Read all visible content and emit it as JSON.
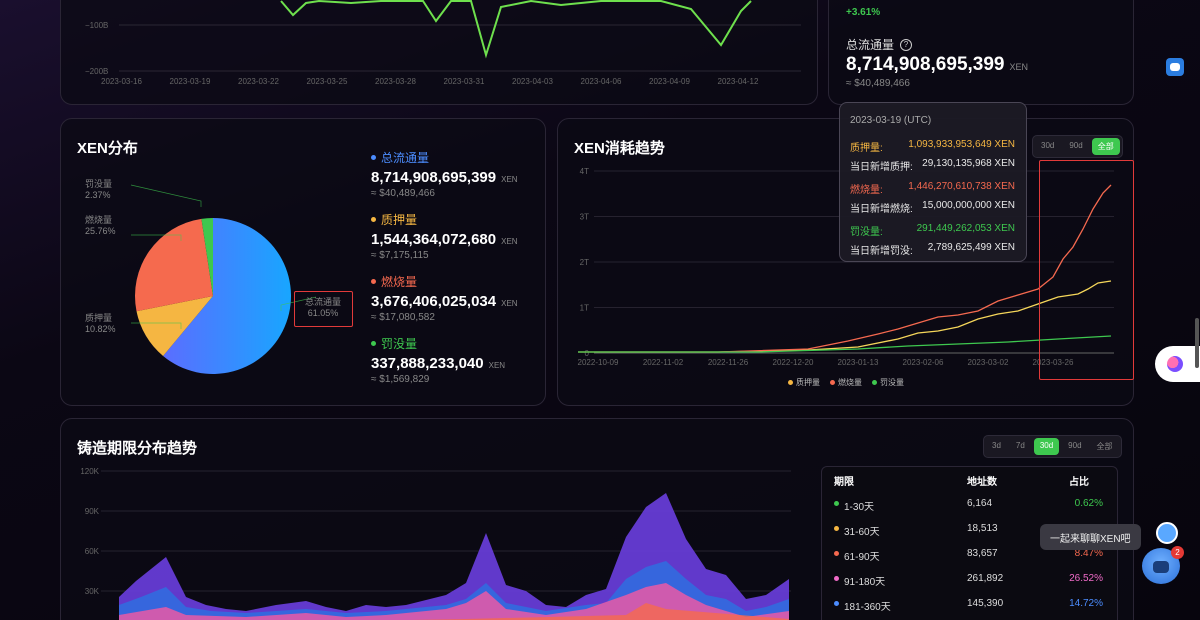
{
  "top_chart": {
    "y_ticks": [
      "−100B",
      "−200B"
    ],
    "x_ticks": [
      "2023-03-16",
      "2023-03-19",
      "2023-03-22",
      "2023-03-25",
      "2023-03-28",
      "2023-03-31",
      "2023-04-03",
      "2023-04-06",
      "2023-04-09",
      "2023-04-12"
    ]
  },
  "top_right": {
    "change": "+3.61%",
    "label": "总流通量",
    "value": "8,714,908,695,399",
    "unit": "XEN",
    "usd": "≈ $40,489,466"
  },
  "distribution": {
    "title": "XEN分布",
    "pie_labels": [
      {
        "name": "罚没量",
        "pct": "2.37%"
      },
      {
        "name": "燃烧量",
        "pct": "25.76%"
      },
      {
        "name": "质押量",
        "pct": "10.82%"
      },
      {
        "name": "总流通量",
        "pct": "61.05%"
      }
    ],
    "legend": [
      {
        "name": "总流通量",
        "value": "8,714,908,695,399",
        "unit": "XEN",
        "usd": "≈ $40,489,466",
        "color": "#4c8dff"
      },
      {
        "name": "质押量",
        "value": "1,544,364,072,680",
        "unit": "XEN",
        "usd": "≈ $7,175,115",
        "color": "#f5b642"
      },
      {
        "name": "燃烧量",
        "value": "3,676,406,025,034",
        "unit": "XEN",
        "usd": "≈ $17,080,582",
        "color": "#f5694f"
      },
      {
        "name": "罚没量",
        "value": "337,888,233,040",
        "unit": "XEN",
        "usd": "≈ $1,569,829",
        "color": "#3ec84f"
      }
    ]
  },
  "consumption": {
    "title": "XEN消耗趋势",
    "ranges": [
      "30d",
      "90d",
      "全部"
    ],
    "active": "全部",
    "y_ticks": [
      "4T",
      "3T",
      "2T",
      "1T",
      "0"
    ],
    "x_ticks": [
      "2022-10-09",
      "2022-11-02",
      "2022-11-26",
      "2022-12-20",
      "2023-01-13",
      "2023-02-06",
      "2023-03-02",
      "2023-03-26"
    ],
    "legend": [
      "质押量",
      "燃烧量",
      "罚没量"
    ],
    "tooltip": {
      "date": "2023-03-19 (UTC)",
      "rows": [
        {
          "k": "质押量:",
          "v": "1,093,933,953,649 XEN",
          "color": "#f5b642"
        },
        {
          "k": "当日新增质押:",
          "v": "29,130,135,968 XEN",
          "color": "#e8e8e8"
        },
        {
          "k": "燃烧量:",
          "v": "1,446,270,610,738 XEN",
          "color": "#f5694f"
        },
        {
          "k": "当日新增燃烧:",
          "v": "15,000,000,000 XEN",
          "color": "#e8e8e8"
        },
        {
          "k": "罚没量:",
          "v": "291,449,262,053 XEN",
          "color": "#3ec84f"
        },
        {
          "k": "当日新增罚没:",
          "v": "2,789,625,499 XEN",
          "color": "#e8e8e8"
        }
      ]
    }
  },
  "mint_term": {
    "title": "铸造期限分布趋势",
    "ranges": [
      "3d",
      "7d",
      "30d",
      "90d",
      "全部"
    ],
    "active": "30d",
    "y_ticks": [
      "120K",
      "90K",
      "60K",
      "30K"
    ],
    "table": {
      "headers": [
        "期限",
        "地址数",
        "占比"
      ],
      "rows": [
        {
          "term": "1-30天",
          "count": "6,164",
          "pct": "0.62%",
          "color": "#3ec84f"
        },
        {
          "term": "31-60天",
          "count": "18,513",
          "pct": "",
          "color": "#f5b642"
        },
        {
          "term": "61-90天",
          "count": "83,657",
          "pct": "8.47%",
          "color": "#f5694f"
        },
        {
          "term": "91-180天",
          "count": "261,892",
          "pct": "26.52%",
          "color": "#f06bc8"
        },
        {
          "term": "181-360天",
          "count": "145,390",
          "pct": "14.72%",
          "color": "#4c8dff"
        }
      ]
    }
  },
  "chat": {
    "bubble": "一起来聊聊XEN吧",
    "badge": "2"
  },
  "colors": {
    "accent": "#3ec84f",
    "stake": "#f5b642",
    "burn": "#f5694f",
    "penalty": "#3ec84f",
    "supply": "#4c8dff"
  }
}
